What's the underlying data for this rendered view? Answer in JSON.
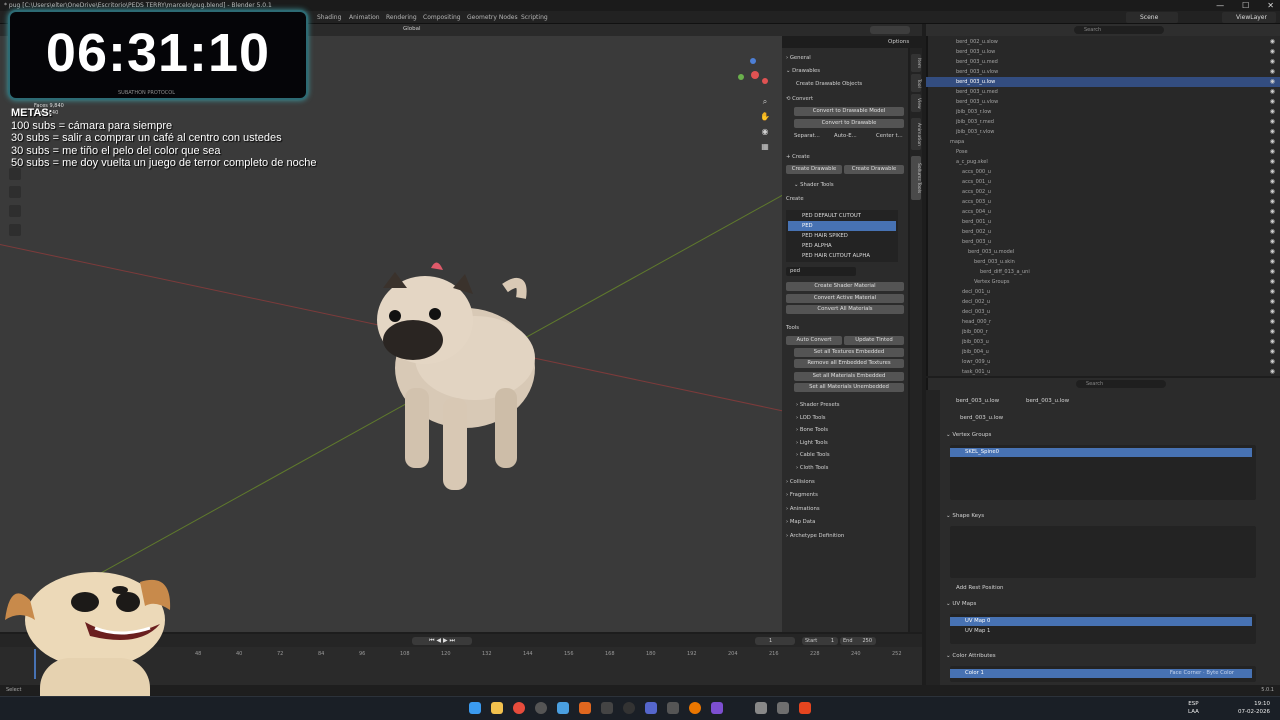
{
  "window": {
    "title": "* pug [C:\\Users\\elter\\OneDrive\\Escritorio\\PEDS TERRY\\marcelo\\pug.blend] - Blender 5.0.1",
    "controls": [
      "—",
      "☐",
      "✕"
    ]
  },
  "menubar": {
    "workspaces": [
      "Shading",
      "Animation",
      "Rendering",
      "Compositing",
      "Geometry Nodes",
      "Scripting"
    ],
    "scene": "Scene",
    "view_layer": "ViewLayer"
  },
  "viewport": {
    "orientation": "Global",
    "options": "Options",
    "stats": [
      "Faces 9,840",
      "Tris 9,840"
    ]
  },
  "overlay": {
    "timer": "06:31:10",
    "timer_sub": "SUBATHON PROTOCOL",
    "metas_title": "METAS:",
    "metas": [
      "100 subs = cámara para siempre",
      "30 subs = salir a comprar un café al centro con ustedes",
      "30 subs = me tiño el pelo del color que sea",
      "50 subs = me doy vuelta un juego de terror completo de noche"
    ]
  },
  "npanel": {
    "general": "General",
    "drawables": "Drawables",
    "create_drawable_objects": "Create Drawable Objects",
    "convert": "Convert",
    "convert_to_drawable_model": "Convert to Drawable Model",
    "convert_to_drawable": "Convert to Drawable",
    "separate": "Separat...",
    "auto_e": "Auto-E...",
    "center": "Center t...",
    "create": "Create",
    "create_drawable_1": "Create Drawable",
    "create_drawable_2": "Create Drawable",
    "shader_tools": "Shader Tools",
    "create_label": "Create",
    "shader_list": [
      "PED DEFAULT CUTOUT",
      "PED",
      "PED HAIR SPIKED",
      "PED ALPHA",
      "PED HAIR CUTOUT ALPHA"
    ],
    "shader_filter": "ped",
    "create_shader_material": "Create Shader Material",
    "convert_active_material": "Convert Active Material",
    "convert_all_materials": "Convert All Materials",
    "tools": "Tools",
    "auto_convert": "Auto Convert",
    "update_tinted": "Update Tinted",
    "set_all_textures_embedded": "Set all Textures Embedded",
    "remove_all_embedded_textures": "Remove all Embedded Textures",
    "set_all_materials_embedded": "Set all Materials Embedded",
    "set_all_materials_unembedded": "Set all Materials Unembedded",
    "sections": [
      "Shader Presets",
      "LOD Tools",
      "Bone Tools",
      "Light Tools",
      "Cable Tools",
      "Cloth Tools"
    ],
    "categories": [
      "Collisions",
      "Fragments",
      "Animations",
      "Map Data",
      "Archetype Definition"
    ],
    "side_tabs": [
      "Item",
      "Tool",
      "View",
      "Animation",
      "Sollumz Tools"
    ]
  },
  "outliner": {
    "search_placeholder": "Search",
    "rows": [
      {
        "label": "berd_002_u.slow",
        "sel": false
      },
      {
        "label": "berd_003_u.low",
        "sel": false
      },
      {
        "label": "berd_003_u.med",
        "sel": false
      },
      {
        "label": "berd_003_u.vlow",
        "sel": false
      },
      {
        "label": "berd_003_u.low",
        "sel": true
      },
      {
        "label": "berd_003_u.med",
        "sel": false
      },
      {
        "label": "berd_003_u.vlow",
        "sel": false
      },
      {
        "label": "jbib_003_r.low",
        "sel": false
      },
      {
        "label": "jbib_003_r.med",
        "sel": false
      },
      {
        "label": "jbib_003_r.vlow",
        "sel": false
      },
      {
        "label": "mapa",
        "sel": false
      },
      {
        "label": "Pose",
        "sel": false
      },
      {
        "label": "a_c_pug.skel",
        "sel": false
      },
      {
        "label": "accs_000_u",
        "sel": false
      },
      {
        "label": "accs_001_u",
        "sel": false
      },
      {
        "label": "accs_002_u",
        "sel": false
      },
      {
        "label": "accs_003_u",
        "sel": false
      },
      {
        "label": "accs_004_u",
        "sel": false
      },
      {
        "label": "berd_001_u",
        "sel": false
      },
      {
        "label": "berd_002_u",
        "sel": false
      },
      {
        "label": "berd_003_u",
        "sel": false
      },
      {
        "label": "berd_003_u.model",
        "sel": false
      },
      {
        "label": "berd_003_u.skin",
        "sel": false
      },
      {
        "label": "berd_diff_013_a_uni",
        "sel": false
      },
      {
        "label": "Vertex Groups",
        "sel": false
      },
      {
        "label": "decl_001_u",
        "sel": false
      },
      {
        "label": "decl_002_u",
        "sel": false
      },
      {
        "label": "decl_003_u",
        "sel": false
      },
      {
        "label": "head_000_r",
        "sel": false
      },
      {
        "label": "jbib_000_r",
        "sel": false
      },
      {
        "label": "jbib_003_u",
        "sel": false
      },
      {
        "label": "jbib_004_u",
        "sel": false
      },
      {
        "label": "lowr_009_u",
        "sel": false
      },
      {
        "label": "task_001_u",
        "sel": false
      }
    ]
  },
  "properties": {
    "search_placeholder": "Search",
    "breadcrumb_1": "berd_003_u.low",
    "breadcrumb_2": "berd_003_u.low",
    "object_name": "berd_003_u.low",
    "vertex_groups": "Vertex Groups",
    "vertex_group_items": [
      "SKEL_Spine0"
    ],
    "shape_keys": "Shape Keys",
    "add_rest_position": "Add Rest Position",
    "uv_maps": "UV Maps",
    "uv_items": [
      "UV Map 0",
      "UV Map 1"
    ],
    "color_attributes": "Color Attributes",
    "color_items": [
      "Color 1"
    ],
    "color_detail": "Face Corner · Byte Color"
  },
  "timeline": {
    "current_frame": "1",
    "start_label": "Start",
    "start": "1",
    "end_label": "End",
    "end": "250",
    "ticks": [
      "48",
      "40",
      "72",
      "84",
      "96",
      "108",
      "120",
      "132",
      "144",
      "156",
      "168",
      "180",
      "192",
      "204",
      "216",
      "228",
      "240",
      "252"
    ]
  },
  "status": {
    "left": "Select",
    "version": "5.0.1"
  },
  "taskbar": {
    "lang_1": "ESP",
    "lang_2": "LAA",
    "time": "19:10",
    "date": "07-02-2026"
  },
  "colors": {
    "selection": "#334d80",
    "accent": "#4772b3",
    "object_orange": "#e79a3c",
    "mesh_green": "#6ac28a"
  }
}
